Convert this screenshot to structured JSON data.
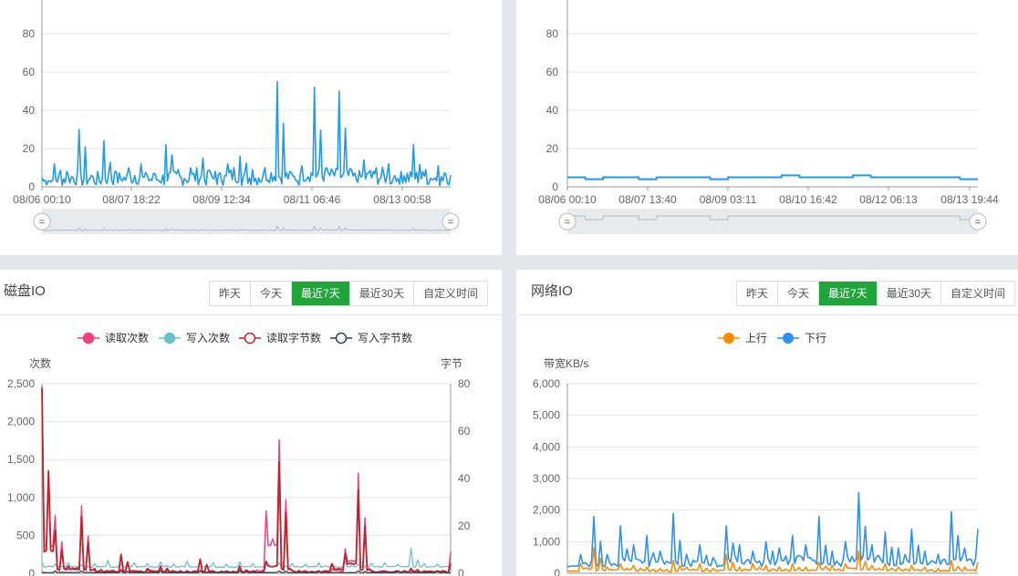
{
  "top_left_chart": {
    "y_ticks": [
      "0",
      "20",
      "40",
      "60",
      "80"
    ],
    "x_ticks": [
      "08/06 00:10",
      "08/07 18:22",
      "08/09 12:34",
      "08/11 06:46",
      "08/13 00:58"
    ],
    "slider_handle_glyph": "="
  },
  "top_right_chart": {
    "y_ticks": [
      "0",
      "20",
      "40",
      "60",
      "80"
    ],
    "x_ticks": [
      "08/06 00:10",
      "08/07 13:40",
      "08/09 03:11",
      "08/10 16:42",
      "08/12 06:13",
      "08/13 19:44"
    ],
    "slider_handle_glyph": "="
  },
  "disk_io": {
    "title": "磁盘IO",
    "buttons": [
      "昨天",
      "今天",
      "最近7天",
      "最近30天",
      "自定义时间"
    ],
    "active_button": 2,
    "legend": [
      "读取次数",
      "写入次数",
      "读取字节数",
      "写入字节数"
    ],
    "left_axis_name": "次数",
    "right_axis_name": "字节",
    "left_ticks": [
      "0",
      "500",
      "1,000",
      "1,500",
      "2,000",
      "2,500"
    ],
    "right_ticks": [
      "0",
      "20",
      "40",
      "60",
      "80"
    ]
  },
  "network_io": {
    "title": "网络IO",
    "buttons": [
      "昨天",
      "今天",
      "最近7天",
      "最近30天",
      "自定义时间"
    ],
    "active_button": 2,
    "legend": [
      "上行",
      "下行"
    ],
    "axis_name": "带宽KB/s",
    "y_ticks": [
      "0",
      "1,000",
      "2,000",
      "3,000",
      "4,000",
      "5,000",
      "6,000"
    ]
  },
  "colors": {
    "accent": "#20a53a",
    "cpu_line": "#209be9",
    "read_count": "#f0417c",
    "write_count": "#6dbfcf",
    "read_bytes": "#c0232b",
    "write_bytes": "#33414e",
    "upload": "#ff8c00",
    "download": "#2e90f0"
  },
  "chart_data": [
    {
      "type": "line",
      "x": [
        "08/06 00:10",
        "08/07 18:22",
        "08/09 12:34",
        "08/11 06:46",
        "08/13 00:58"
      ],
      "series": [
        {
          "values": [
            5,
            12,
            8,
            30,
            6,
            24,
            8,
            10,
            12,
            7,
            22,
            9,
            10,
            15,
            8,
            12,
            16,
            9,
            10,
            55,
            8,
            11,
            52,
            10,
            50,
            9,
            14,
            10,
            12,
            8,
            22,
            9,
            11,
            6
          ]
        }
      ],
      "ylim": [
        0,
        80
      ]
    },
    {
      "type": "line",
      "x": [
        "08/06 00:10",
        "08/07 13:40",
        "08/09 03:11",
        "08/10 16:42",
        "08/12 06:13",
        "08/13 19:44"
      ],
      "series": [
        {
          "values": [
            5,
            4,
            5,
            5,
            4,
            5,
            5,
            5,
            4,
            5,
            5,
            5,
            6,
            5,
            5,
            5,
            6,
            5,
            5,
            5,
            5,
            5,
            4
          ]
        }
      ],
      "ylim": [
        0,
        80
      ]
    },
    {
      "type": "line",
      "series": [
        {
          "name": "读取次数",
          "values": [
            2470,
            760,
            60,
            890,
            40,
            30,
            50,
            20,
            40,
            60,
            30,
            20,
            40,
            30,
            20,
            50,
            30,
            820,
            1760,
            40,
            30,
            20,
            60,
            320,
            1320,
            40,
            30,
            20,
            40,
            30,
            20,
            280
          ]
        },
        {
          "name": "写入次数",
          "values": [
            150,
            120,
            140,
            110,
            130,
            170,
            120,
            140,
            130,
            150,
            120,
            160,
            130,
            140,
            120,
            150,
            130,
            120,
            140,
            130,
            120,
            140,
            130,
            150,
            120,
            130,
            140,
            120,
            330,
            130,
            120,
            150
          ]
        },
        {
          "name": "读取字节数",
          "values": [
            78,
            18,
            3,
            24,
            2,
            1,
            8,
            1,
            2,
            3,
            1,
            1,
            6,
            1,
            1,
            3,
            1,
            5,
            47,
            1,
            1,
            1,
            4,
            8,
            35,
            1,
            1,
            1,
            2,
            1,
            1,
            4
          ]
        },
        {
          "name": "写入字节数",
          "values": [
            0,
            1,
            0,
            1,
            0,
            0,
            1,
            0,
            0,
            1,
            0,
            0,
            1,
            0,
            0,
            1,
            0,
            0,
            1,
            0,
            0,
            1,
            0,
            0,
            1,
            0,
            0,
            1,
            0,
            0,
            1,
            0
          ]
        }
      ],
      "ylim": [
        0,
        2500
      ],
      "ylabel": "次数",
      "y2lim": [
        0,
        80
      ],
      "y2label": "字节"
    },
    {
      "type": "line",
      "series": [
        {
          "name": "上行",
          "values": [
            100,
            300,
            800,
            200,
            300,
            250,
            200,
            150,
            400,
            200,
            300,
            150,
            600,
            200,
            300,
            250,
            200,
            300,
            200,
            350,
            250,
            300,
            700,
            250,
            300,
            200,
            250,
            200,
            150,
            400,
            200,
            350
          ]
        },
        {
          "name": "下行",
          "values": [
            200,
            600,
            1800,
            600,
            1500,
            900,
            1200,
            700,
            1900,
            600,
            900,
            500,
            1500,
            900,
            700,
            1000,
            800,
            1200,
            900,
            1800,
            700,
            1000,
            2550,
            900,
            1300,
            800,
            1400,
            700,
            600,
            1950,
            800,
            1400
          ]
        }
      ],
      "ylim": [
        0,
        6000
      ],
      "ylabel": "带宽KB/s"
    }
  ]
}
